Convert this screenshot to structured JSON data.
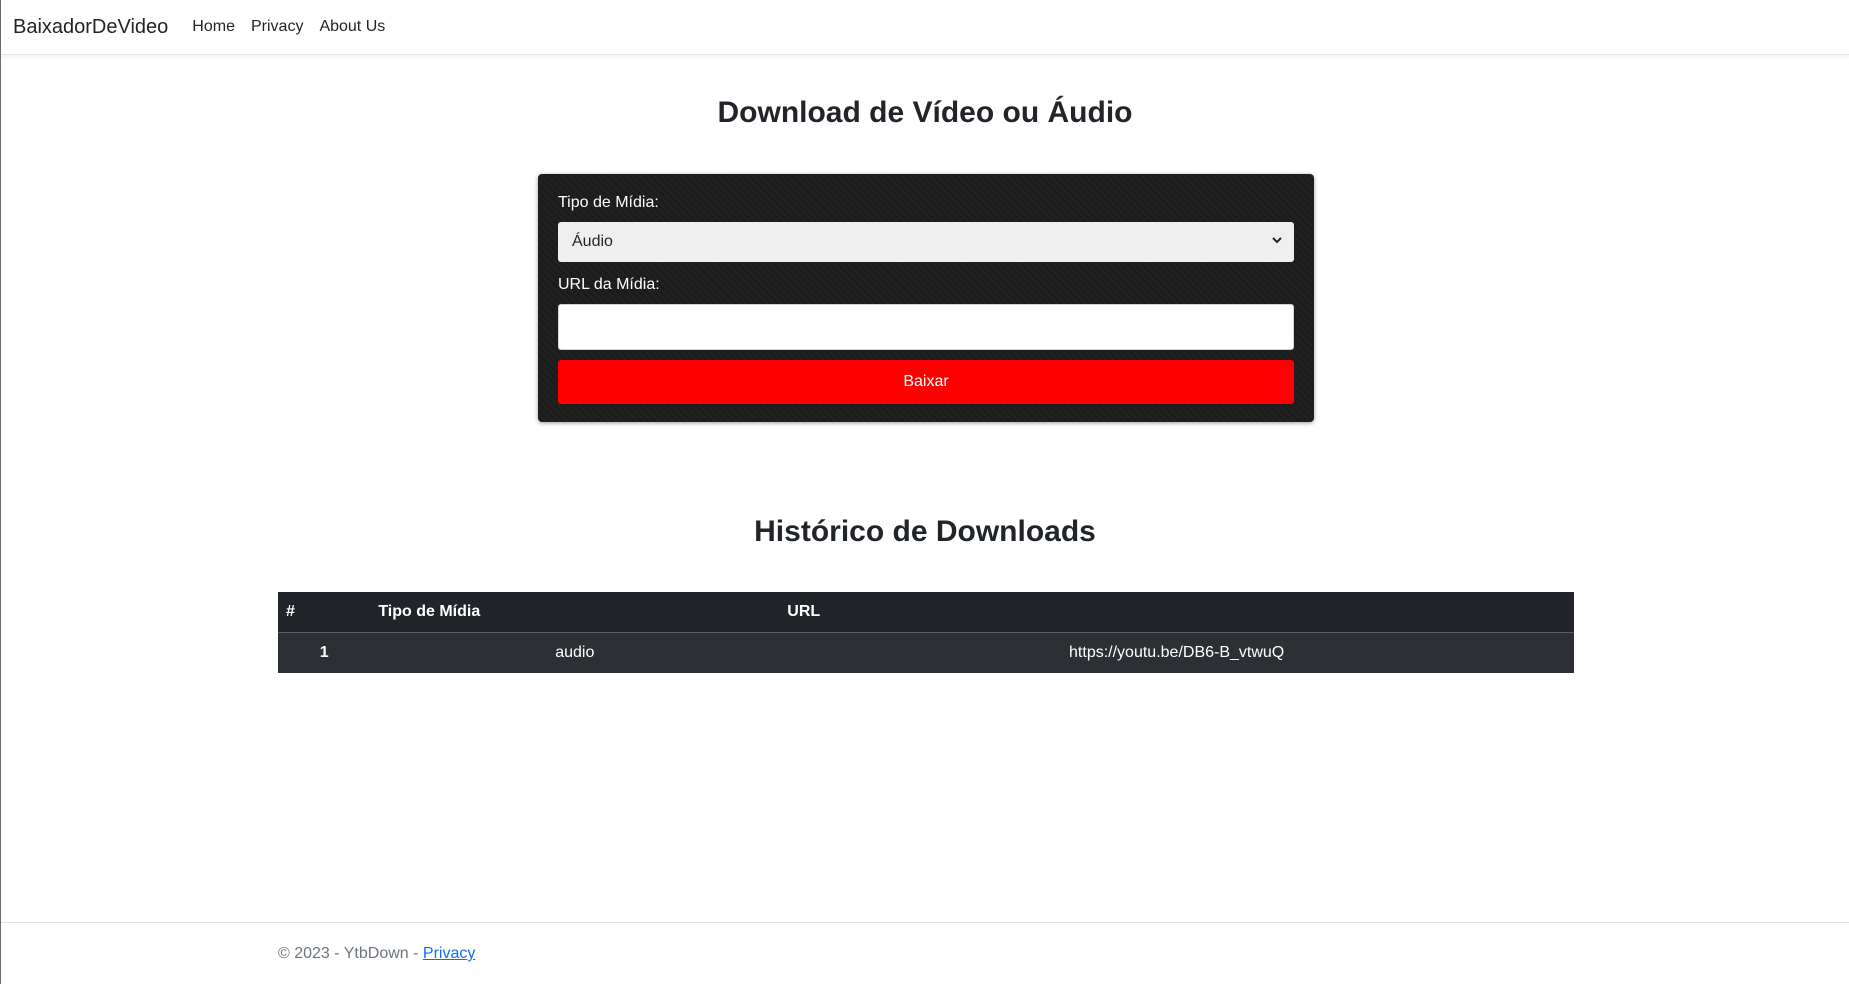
{
  "navbar": {
    "brand": "BaixadorDeVideo",
    "links": [
      "Home",
      "Privacy",
      "About Us"
    ]
  },
  "main": {
    "title": "Download de Vídeo ou Áudio",
    "form": {
      "media_type_label": "Tipo de Mídia:",
      "media_type_selected": "Áudio",
      "url_label": "URL da Mídia:",
      "url_value": "",
      "submit_label": "Baixar"
    }
  },
  "history": {
    "title": "Histórico de Downloads",
    "columns": [
      "#",
      "Tipo de Mídia",
      "URL"
    ],
    "rows": [
      {
        "num": "1",
        "type": "audio",
        "url": "https://youtu.be/DB6-B_vtwuQ"
      }
    ]
  },
  "footer": {
    "text": "© 2023 - YtbDown - ",
    "link": "Privacy"
  },
  "colors": {
    "accent_button": "#ff0000",
    "panel_bg": "#1c1c1c",
    "table_bg": "#212529",
    "link": "#0d6efd"
  }
}
